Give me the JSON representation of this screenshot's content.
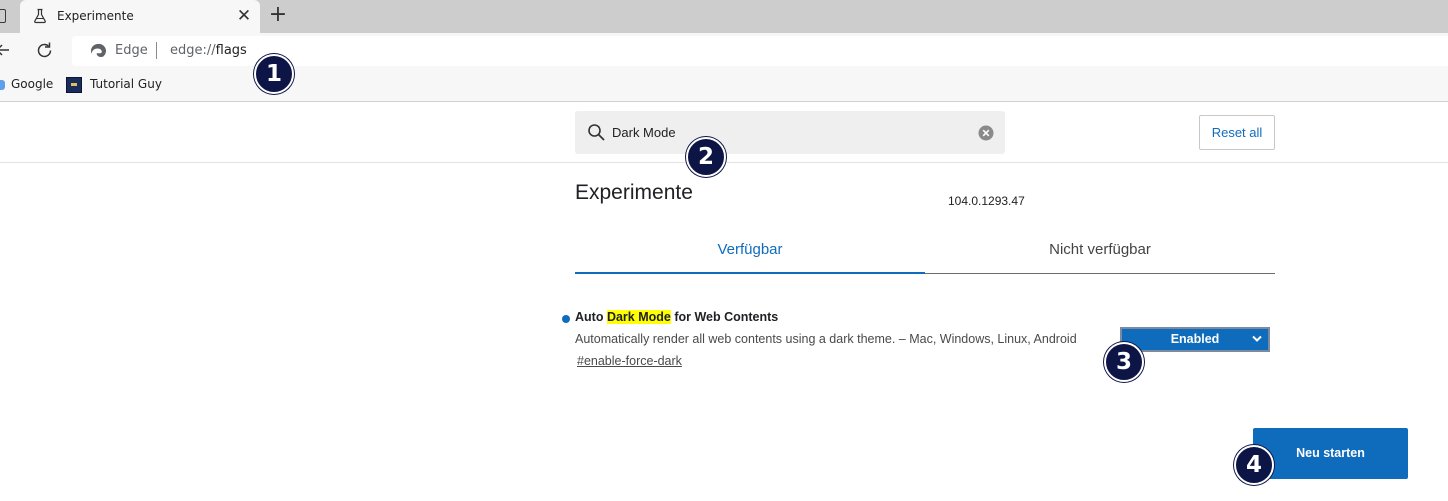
{
  "browser": {
    "tab": {
      "title": "Experimente",
      "close_glyph": "✕",
      "favicon": "flask-icon"
    },
    "new_tab_glyph": "+",
    "address_bar": {
      "site_label": "Edge",
      "url_scheme": "edge://",
      "url_host": "flags"
    },
    "bookmarks": [
      {
        "label": "Google",
        "icon": "google-favicon"
      },
      {
        "label": "Tutorial Guy",
        "icon": "tutorial-guy-favicon"
      }
    ]
  },
  "flags": {
    "search": {
      "value": "Dark Mode",
      "placeholder": ""
    },
    "reset_all_label": "Reset all",
    "title": "Experimente",
    "version": "104.0.1293.47",
    "tabs": [
      {
        "label": "Verfügbar",
        "active": true
      },
      {
        "label": "Nicht verfügbar",
        "active": false
      }
    ],
    "experiment": {
      "title_before": "Auto ",
      "title_highlight": "Dark Mode",
      "title_after": " for Web Contents",
      "description": "Automatically render all web contents using a dark theme. – Mac, Windows, Linux, Android",
      "link": "#enable-force-dark",
      "select_value": "Enabled"
    },
    "relaunch_label": "Neu starten"
  },
  "badges": [
    "1",
    "2",
    "3",
    "4"
  ],
  "colors": {
    "accent": "#0f6cbd",
    "highlight": "#ffff00",
    "badge": "#0c1545",
    "tabstrip": "#cdcdcd",
    "toolbar": "#f7f7f7"
  }
}
